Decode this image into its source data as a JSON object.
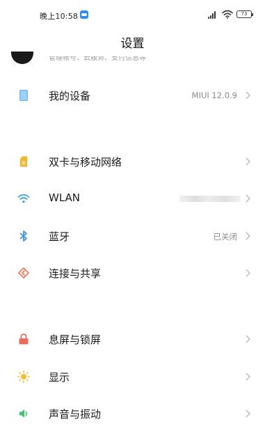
{
  "status_bar": {
    "time": "晚上10:58",
    "battery": "73"
  },
  "title": "设置",
  "account": {
    "subtitle": "管理帐号、云服务、支付信息等"
  },
  "items": [
    {
      "key": "my-device",
      "label": "我的设备",
      "value": "MIUI 12.0.9",
      "icon": "device-icon",
      "color": "#5aa9e8"
    },
    {
      "key": "dual-sim",
      "label": "双卡与移动网络",
      "value": "",
      "icon": "sim-card-icon",
      "color": "#f5b62f"
    },
    {
      "key": "wlan",
      "label": "WLAN",
      "value": "",
      "icon": "wifi-icon",
      "color": "#3aa0e6"
    },
    {
      "key": "bluetooth",
      "label": "蓝牙",
      "value": "已关闭",
      "icon": "bluetooth-icon",
      "color": "#3d8ee6"
    },
    {
      "key": "connection-sharing",
      "label": "连接与共享",
      "value": "",
      "icon": "share-icon",
      "color": "#ef7a5a"
    },
    {
      "key": "lock-screen",
      "label": "息屏与锁屏",
      "value": "",
      "icon": "lock-icon",
      "color": "#ee6a5a"
    },
    {
      "key": "display",
      "label": "显示",
      "value": "",
      "icon": "sun-icon",
      "color": "#f5c02e"
    },
    {
      "key": "sound",
      "label": "声音与振动",
      "value": "",
      "icon": "speaker-icon",
      "color": "#3cc46e"
    }
  ]
}
